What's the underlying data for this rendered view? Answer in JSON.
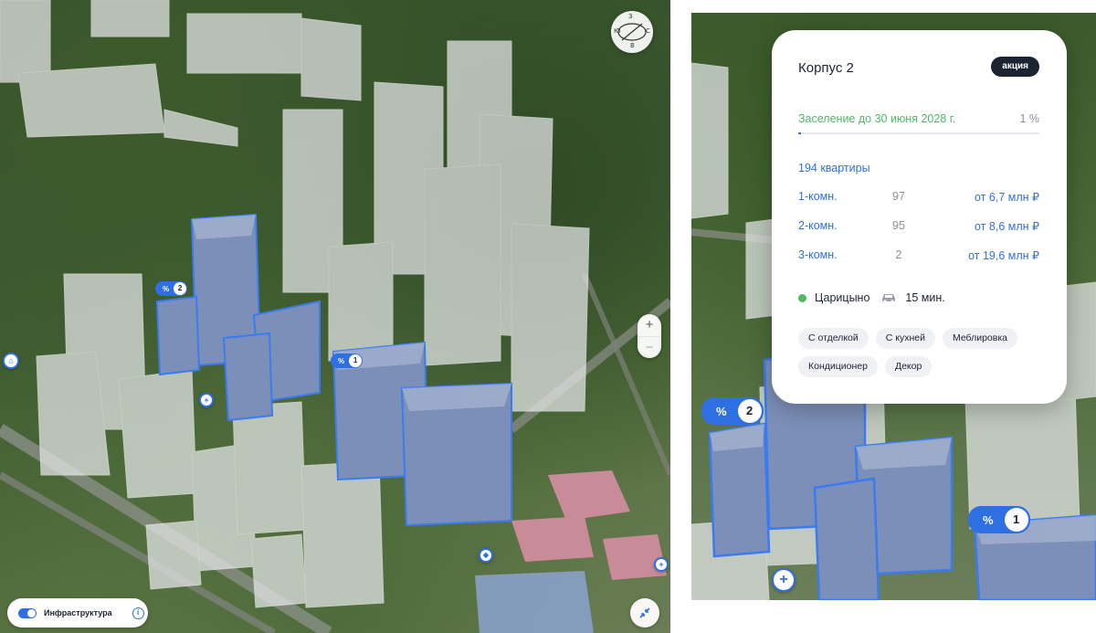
{
  "map": {
    "compass": {
      "letters": [
        "З",
        "С",
        "Ю",
        "В"
      ]
    },
    "zoom": {
      "in": "+",
      "out": "−"
    },
    "infrastructure": {
      "label": "Инфраструктура",
      "enabled": true,
      "info": "i"
    },
    "badges_left": [
      {
        "pct": "%",
        "num": "2"
      },
      {
        "pct": "%",
        "num": "1"
      }
    ],
    "badges_right": [
      {
        "pct": "%",
        "num": "2"
      },
      {
        "pct": "%",
        "num": "1"
      }
    ]
  },
  "card": {
    "title": "Корпус 2",
    "promo": "акция",
    "settlement": "Заселение до 30 июня 2028 г.",
    "progress_pct": "1 %",
    "progress_value": 0.01,
    "apartments_total": "194 квартиры",
    "apartments": [
      {
        "rooms": "1-комн.",
        "count": "97",
        "price": "от 6,7 млн ₽"
      },
      {
        "rooms": "2-комн.",
        "count": "95",
        "price": "от 8,6 млн ₽"
      },
      {
        "rooms": "3-комн.",
        "count": "2",
        "price": "от 19,6 млн ₽"
      }
    ],
    "metro": {
      "station": "Царицыно",
      "time": "15 мин."
    },
    "tags": [
      "С отделкой",
      "С кухней",
      "Меблировка",
      "Кондиционер",
      "Декор"
    ]
  },
  "colors": {
    "accent": "#2f6fe4",
    "green": "#4cb963",
    "dark": "#1c2333"
  }
}
